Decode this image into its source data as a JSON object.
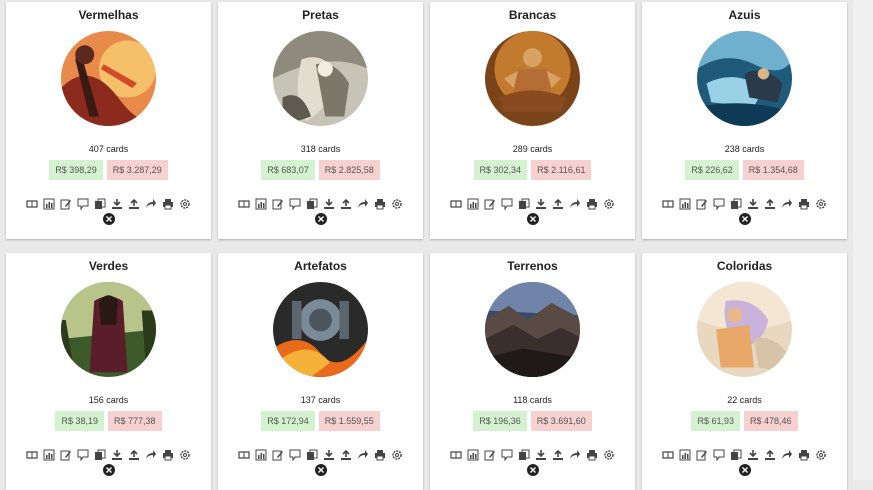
{
  "decks": [
    {
      "title": "Vermelhas",
      "cards": "407 cards",
      "buy": "R$ 398,29",
      "sell": "R$ 3.287,29"
    },
    {
      "title": "Pretas",
      "cards": "318 cards",
      "buy": "R$ 683,07",
      "sell": "R$ 2.825,58"
    },
    {
      "title": "Brancas",
      "cards": "289 cards",
      "buy": "R$ 302,34",
      "sell": "R$ 2.116,61"
    },
    {
      "title": "Azuis",
      "cards": "238 cards",
      "buy": "R$ 226,62",
      "sell": "R$ 1.354,68"
    },
    {
      "title": "Verdes",
      "cards": "156 cards",
      "buy": "R$ 38,19",
      "sell": "R$ 777,38"
    },
    {
      "title": "Artefatos",
      "cards": "137 cards",
      "buy": "R$ 172,94",
      "sell": "R$ 1.559,55"
    },
    {
      "title": "Terrenos",
      "cards": "118 cards",
      "buy": "R$ 196,36",
      "sell": "R$ 3.691,60"
    },
    {
      "title": "Coloridas",
      "cards": "22 cards",
      "buy": "R$ 61,93",
      "sell": "R$ 478,46"
    }
  ],
  "toolbar_icons": [
    "book-icon",
    "chart-icon",
    "edit-icon",
    "comment-icon",
    "copy-icon",
    "download-icon",
    "upload-icon",
    "share-icon",
    "print-icon",
    "gear-icon"
  ],
  "remove_icon": "close-icon",
  "colors": {
    "buy_bg": "#d4f2cf",
    "sell_bg": "#f7d0d0",
    "card_bg": "#ffffff",
    "page_bg": "#e9e9e9"
  }
}
